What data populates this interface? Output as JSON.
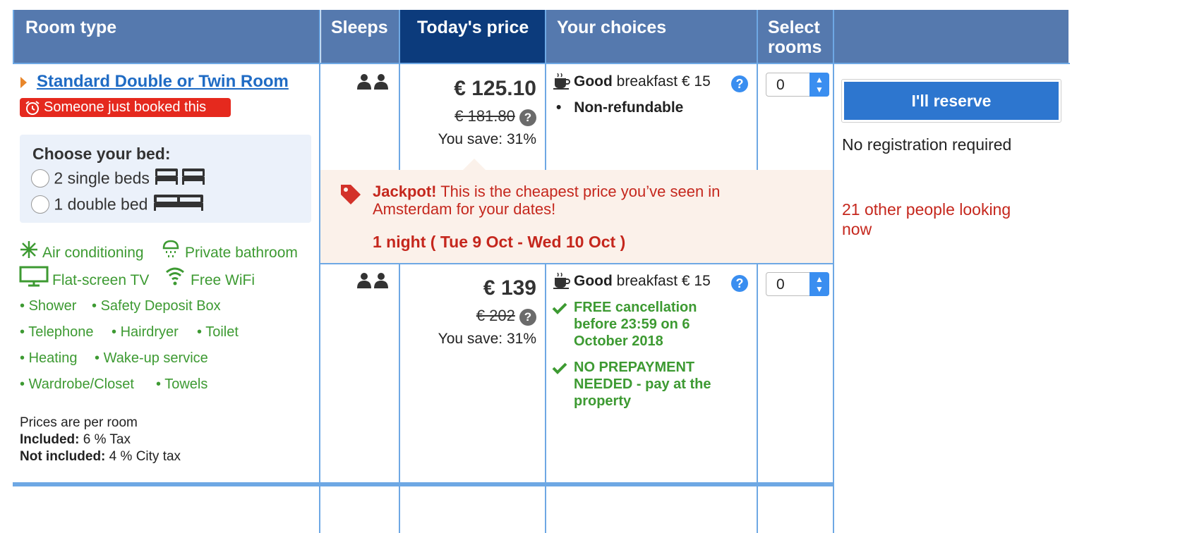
{
  "header": {
    "room_type": "Room type",
    "sleeps": "Sleeps",
    "todays_price": "Today's price",
    "your_choices": "Your choices",
    "select_rooms_1": "Select",
    "select_rooms_2": "rooms"
  },
  "room": {
    "name": "Standard Double or Twin Room",
    "booked_badge": "Someone just booked this",
    "choose_bed_title": "Choose your bed:",
    "bed_options": [
      "2 single beds",
      "1 double bed"
    ],
    "facilities_icons": [
      "Air conditioning",
      "Private bathroom",
      "Flat-screen TV",
      "Free WiFi"
    ],
    "facilities": [
      "Shower",
      "Safety Deposit Box",
      "Telephone",
      "Hairdryer",
      "Toilet",
      "Heating",
      "Wake-up service",
      "Wardrobe/Closet",
      "Towels"
    ],
    "prices_note": "Prices are per room",
    "included_label": "Included:",
    "included_value": "6 % Tax",
    "not_included_label": "Not included:",
    "not_included_value": "4 % City tax"
  },
  "offers": [
    {
      "price": "€ 125.10",
      "old_price": "€ 181.80",
      "save": "You save: 31%",
      "breakfast_bold": "Good",
      "breakfast_rest": "breakfast € 15",
      "conditions": [
        "Non-refundable"
      ],
      "select_value": "0"
    },
    {
      "price": "€ 139",
      "old_price": "€ 202",
      "save": "You save: 31%",
      "breakfast_bold": "Good",
      "breakfast_rest": "breakfast € 15",
      "conditions": [
        "FREE cancellation before 23:59 on 6 October 2018",
        "NO PREPAYMENT NEEDED - pay at the property"
      ],
      "select_value": "0"
    }
  ],
  "jackpot": {
    "bold": "Jackpot!",
    "line1_rest": "This is the cheapest price you’ve seen in",
    "line2": "Amsterdam for your dates!",
    "nights": "1 night ( Tue 9 Oct - Wed 10 Oct )"
  },
  "reserve": {
    "button": "I'll reserve",
    "no_registration": "No registration required",
    "looking_1": "21 other people looking",
    "looking_2": "now"
  },
  "colors": {
    "header": "#5579ae",
    "header_active": "#0c3b7c",
    "accent": "#3a8ef0",
    "green": "#3d9a32",
    "red": "#c5271d",
    "reserve_button": "#2d76cf"
  },
  "icons": [
    "sleeps-icon",
    "alarm-clock-icon",
    "tag-icon",
    "coffee-cup-icon",
    "snowflake-icon",
    "shower-icon",
    "tv-icon",
    "wifi-icon",
    "check-icon",
    "question-icon"
  ]
}
